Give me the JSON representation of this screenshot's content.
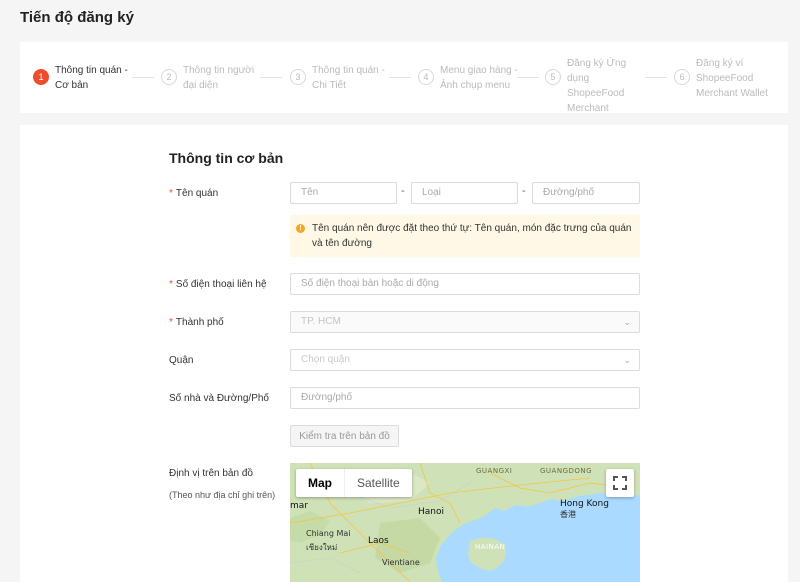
{
  "page": {
    "title": "Tiến độ đăng ký"
  },
  "steps": [
    {
      "num": "1",
      "label": "Thông tin quán - Cơ bản",
      "active": true
    },
    {
      "num": "2",
      "label": "Thông tin người đại diện",
      "active": false
    },
    {
      "num": "3",
      "label": "Thông tin quán - Chi Tiết",
      "active": false
    },
    {
      "num": "4",
      "label": "Menu giao hàng - Ảnh chụp menu",
      "active": false
    },
    {
      "num": "5",
      "label": "Đăng ký Ứng dụng ShopeeFood Merchant",
      "active": false
    },
    {
      "num": "6",
      "label": "Đăng ký ví ShopeeFood Merchant Wallet",
      "active": false
    }
  ],
  "form": {
    "section_title": "Thông tin cơ bản",
    "required_mark": "*",
    "dash": "-",
    "store_name": {
      "label": "Tên quán",
      "name_placeholder": "Tên",
      "type_placeholder": "Loại",
      "street_placeholder": "Đường/phố"
    },
    "notice": "Tên quán nên được đặt theo thứ tự: Tên quán, món đặc trưng của quán và tên đường",
    "phone": {
      "label": "Số điện thoại liên hệ",
      "placeholder": "Số điện thoại bàn hoặc di động"
    },
    "city": {
      "label": "Thành phố",
      "value": "TP. HCM"
    },
    "district": {
      "label": "Quận",
      "placeholder": "Chọn quận"
    },
    "address": {
      "label": "Số nhà và Đường/Phố",
      "placeholder": "Đường/phố"
    },
    "check_button": "Kiểm tra trên bản đồ",
    "map_section": {
      "label": "Định vị trên bản đồ",
      "help": "(Theo như địa chỉ ghi trên)"
    }
  },
  "map": {
    "tabs": [
      "Map",
      "Satellite"
    ],
    "active_tab": "Map",
    "labels": {
      "guangxi": "GUANGXI",
      "guangdong": "GUANGDONG",
      "hanoi": "Hanoi",
      "hongkong": "Hong Kong",
      "hongkong_cn": "香港",
      "laos": "Laos",
      "chiangmai": "Chiang Mai",
      "chiangmai_th": "เชียงใหม่",
      "vientiane": "Vientiane",
      "hainan": "HAINAN",
      "myanmar": "mar"
    },
    "colors": {
      "land": "#cfe2b7",
      "water": "#aadaff",
      "roads": "#f4c542"
    }
  },
  "icons": {
    "warning": "warning-icon",
    "chevron": "chevron-down-icon",
    "fullscreen": "fullscreen-icon"
  }
}
